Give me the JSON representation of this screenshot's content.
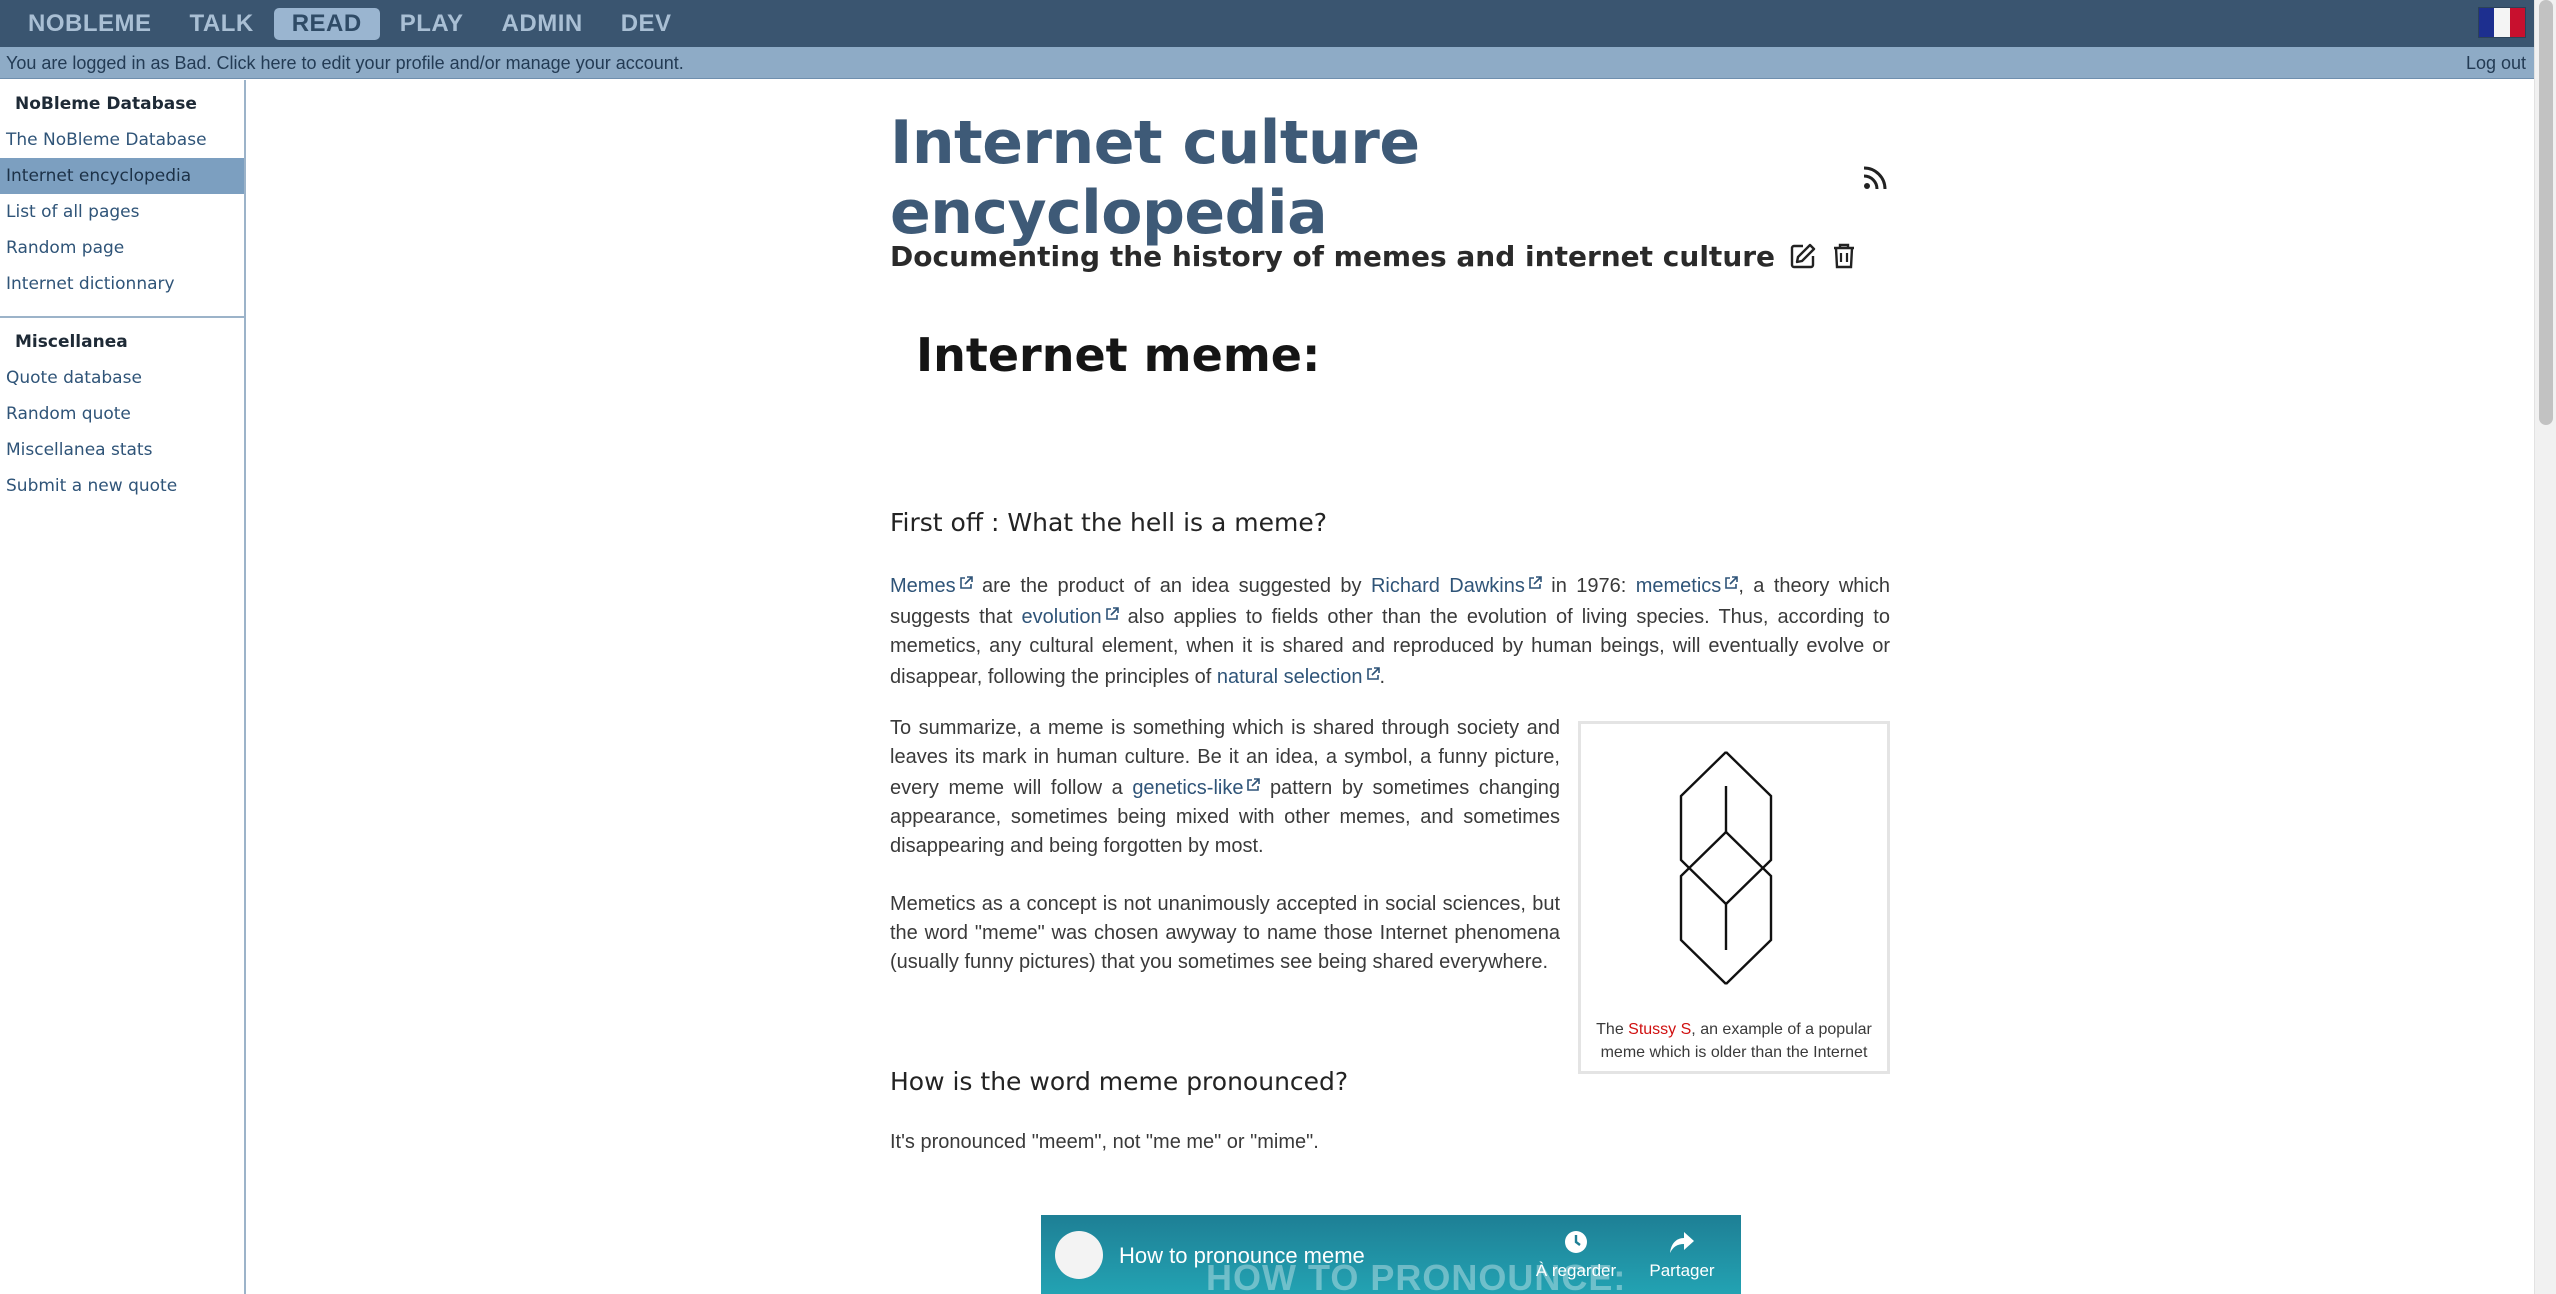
{
  "topnav": {
    "items": [
      "NOBLEME",
      "TALK",
      "READ",
      "PLAY",
      "ADMIN",
      "DEV"
    ],
    "active": "READ"
  },
  "flag": {
    "colors": [
      "#1d2f8f",
      "#f4f4f4",
      "#c8102e"
    ]
  },
  "account_bar": {
    "message": "You are logged in as Bad. Click here to edit your profile and/or manage your account.",
    "logout": "Log out"
  },
  "sidebar": {
    "group1": {
      "title": "NoBleme Database",
      "items": [
        "The NoBleme Database",
        "Internet encyclopedia",
        "List of all pages",
        "Random page",
        "Internet dictionnary"
      ],
      "active_index": 1
    },
    "group2": {
      "title": "Miscellanea",
      "items": [
        "Quote database",
        "Random quote",
        "Miscellanea stats",
        "Submit a new quote"
      ]
    }
  },
  "page": {
    "title": "Internet culture encyclopedia",
    "subtitle": "Documenting the history of memes and internet culture",
    "icons": [
      "rss-icon",
      "edit-icon",
      "trash-icon"
    ]
  },
  "article": {
    "title": "Internet meme:",
    "section1_heading": "First off : What the hell is a meme?",
    "p1": {
      "link_memes": "Memes",
      "t1": " are the product of an idea suggested by ",
      "link_dawkins": "Richard Dawkins",
      "t2": " in 1976: ",
      "link_memetics": "memetics",
      "t3": ", a theory which suggests that ",
      "link_evolution": "evolution",
      "t4": " also applies to fields other than the evolution of living species. Thus, according to memetics, any cultural element, when it is shared and reproduced by human beings, will eventually evolve or disappear, following the principles of ",
      "link_selection": "natural selection",
      "t5": "."
    },
    "p2": {
      "t1": "To summarize, a meme is something which is shared through society and leaves its mark in human culture. Be it an idea, a symbol, a funny picture, every meme will follow a ",
      "link_genetics": "genetics-like",
      "t2": " pattern by sometimes changing appearance, sometimes being mixed with other memes, and sometimes disappearing and being forgotten by most."
    },
    "p3": "Memetics as a concept is not unanimously accepted in social sciences, but the word \"meme\" was chosen awyway to name those Internet phenomena (usually funny pictures) that you sometimes see being shared everywhere.",
    "section2_heading": "How is the word meme pronounced?",
    "p4": "It's pronounced \"meem\", not \"me me\" or \"mime\".",
    "figure": {
      "caption_pre": "The ",
      "caption_link": "Stussy S",
      "caption_post": ", an example of a popular meme which is older than the Internet"
    },
    "video": {
      "title": "How to pronounce meme",
      "watermark": "HOW TO PRONOUNCE:",
      "watch_later": "À regarder ...",
      "share": "Partager"
    }
  }
}
